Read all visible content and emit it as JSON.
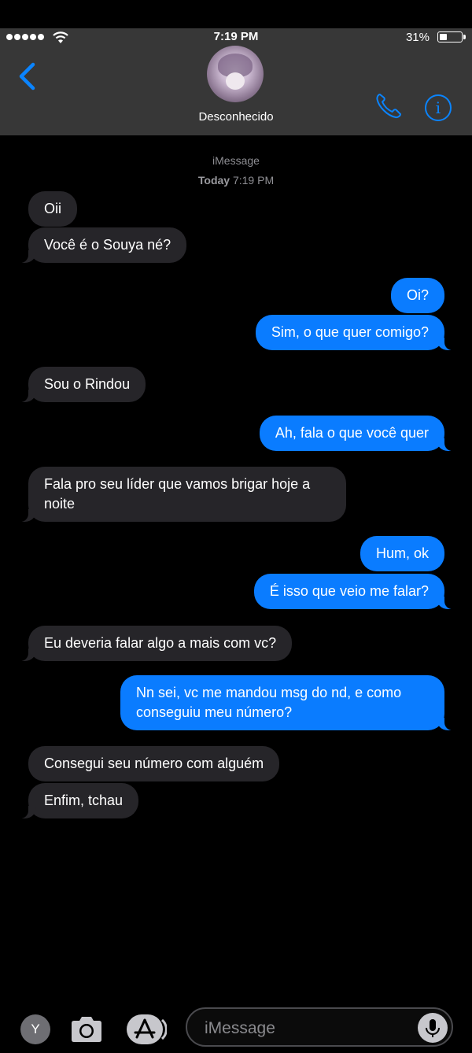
{
  "status_bar": {
    "time": "7:19 PM",
    "battery": "31%",
    "battery_level": 0.31
  },
  "header": {
    "contact_name": "Desconhecido"
  },
  "thread": {
    "service": "iMessage",
    "timestamp_day": "Today",
    "timestamp_time": "7:19 PM"
  },
  "messages": [
    {
      "from": "them",
      "text": "Oii"
    },
    {
      "from": "them",
      "text": "Você é o Souya né?"
    },
    {
      "from": "me",
      "text": "Oi?"
    },
    {
      "from": "me",
      "text": "Sim, o que quer comigo?"
    },
    {
      "from": "them",
      "text": "Sou o Rindou"
    },
    {
      "from": "me",
      "text": "Ah, fala o que você quer"
    },
    {
      "from": "them",
      "text": "Fala pro seu líder que vamos brigar hoje a noite"
    },
    {
      "from": "me",
      "text": "Hum, ok"
    },
    {
      "from": "me",
      "text": "É isso que veio me falar?"
    },
    {
      "from": "them",
      "text": "Eu deveria falar algo a mais com vc?"
    },
    {
      "from": "me",
      "text": "Nn sei, vc me mandou msg do nd, e como conseguiu meu número?"
    },
    {
      "from": "them",
      "text": "Consegui seu número com alguém"
    },
    {
      "from": "them",
      "text": "Enfim, tchau"
    }
  ],
  "composer": {
    "app_label": "Y",
    "placeholder": "iMessage"
  },
  "icons": {
    "back": "chevron-left-icon",
    "call": "phone-icon",
    "info": "info-icon",
    "camera": "camera-icon",
    "apps": "app-store-icon",
    "mic": "microphone-icon"
  },
  "colors": {
    "accent": "#0a84ff",
    "incoming_bubble": "#262529",
    "outgoing_bubble": "#0a7cff",
    "header_bg": "#373737"
  }
}
